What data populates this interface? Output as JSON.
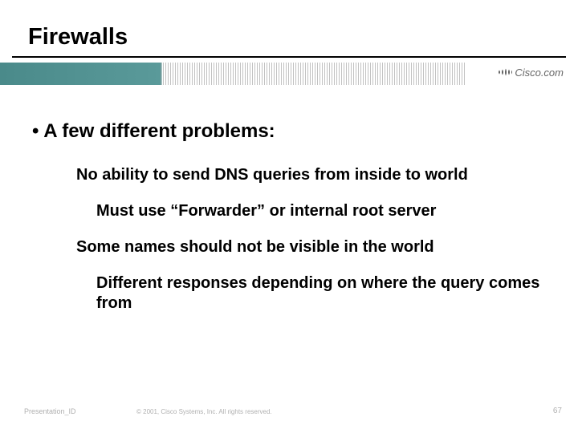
{
  "title": "Firewalls",
  "logo_text": "Cisco.com",
  "bullet_main": "A few different problems:",
  "points": {
    "p1": "No ability to send DNS queries from inside to world",
    "p1a": "Must use “Forwarder” or internal root server",
    "p2": "Some names should not be visible in the world",
    "p2a": "Different responses depending on where the query comes from"
  },
  "footer": {
    "left": "Presentation_ID",
    "center": "© 2001, Cisco Systems, Inc. All rights reserved.",
    "page": "67"
  }
}
